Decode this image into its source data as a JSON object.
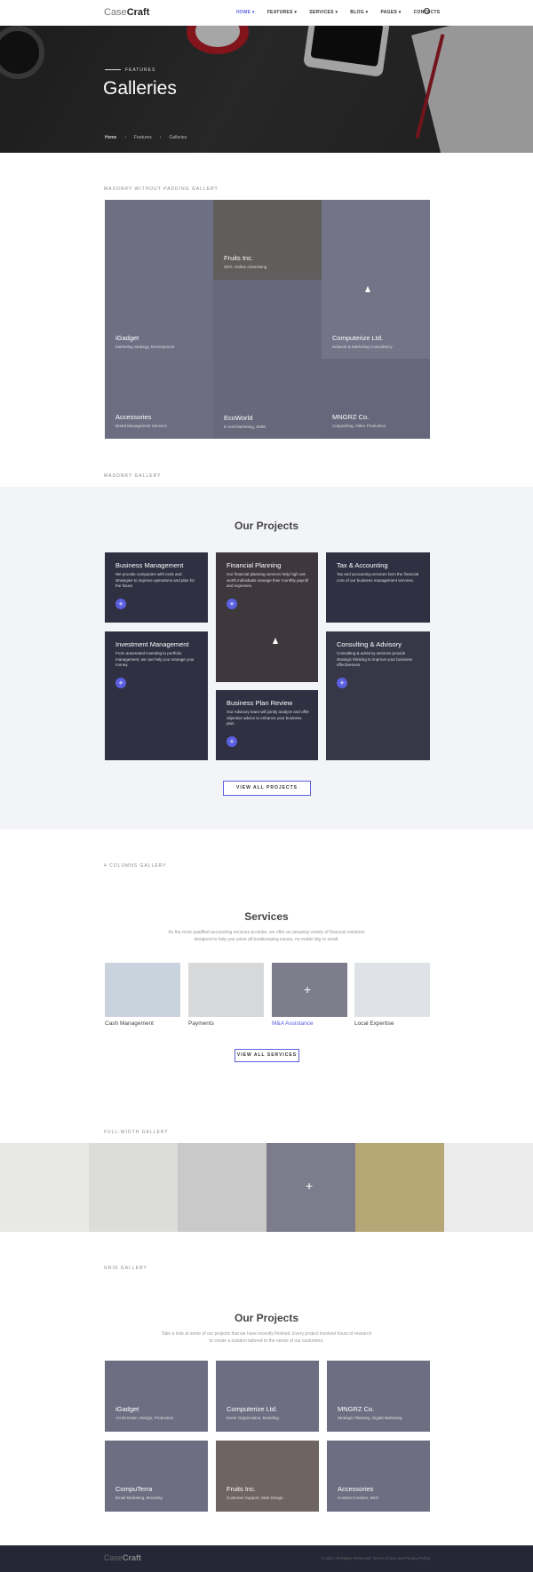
{
  "header": {
    "logo_part1": "Case",
    "logo_part2": "Craft",
    "nav": [
      "HOME",
      "FEATURES",
      "SERVICES",
      "BLOG",
      "PAGES",
      "CONTACTS"
    ],
    "active_nav": "HOME"
  },
  "hero": {
    "subtitle": "FEATURES",
    "title": "Galleries",
    "breadcrumb": [
      "Home",
      "Features",
      "Galleries"
    ]
  },
  "masonry_nopad": {
    "label": "MASONRY WITHOUT PADDING GALLERY",
    "items": [
      {
        "title": "Fruits Inc.",
        "subtitle": "SEO, Online Advertising"
      },
      {
        "title": "iGadget",
        "subtitle": "Marketing Strategy, Development"
      },
      {
        "title": "Computerize Ltd.",
        "subtitle": "Network & Marketing Consultancy"
      },
      {
        "title": "Accessories",
        "subtitle": "Brand Management Services"
      },
      {
        "title": "EcoWorld",
        "subtitle": "E-mail Marketing, SMM"
      },
      {
        "title": "MNGRZ Co.",
        "subtitle": "Copywriting, Video Production"
      }
    ]
  },
  "masonry": {
    "label": "MASONRY GALLERY",
    "heading": "Our Projects",
    "items": [
      {
        "title": "Business Management",
        "text": "We provide companies with tools and strategies to improve operations and plan for the future."
      },
      {
        "title": "Financial Planning",
        "text": "Our financial planning services help high net-worth individuals manage their monthly payroll and expenses."
      },
      {
        "title": "Tax & Accounting",
        "text": "Tax and accounting services form the financial core of our business management services."
      },
      {
        "title": "Investment Management",
        "text": "From automated investing to portfolio management, we can help you manage your money."
      },
      {
        "title": "Consulting & Advisory",
        "text": "Consulting & advisory services provide strategic thinking to improve your business effectiveness."
      },
      {
        "title": "Business Plan Review",
        "text": "Our Advisory team will jointly analyze and offer objective advice to enhance your business plan."
      }
    ],
    "button": "VIEW ALL PROJECTS"
  },
  "columns": {
    "label": "4 COLUMNS GALLERY",
    "heading": "Services",
    "description": "As the most qualified accounting services provider, we offer an amazing variety of financial solutions designed to help you solve all bookkeeping issues, no matter big or small.",
    "items": [
      "Cash Management",
      "Payments",
      "M&A Assistance",
      "Local Expertise"
    ],
    "active_item": "M&A Assistance",
    "button": "VIEW ALL SERVICES"
  },
  "fullwidth": {
    "label": "FULL-WIDTH GALLERY"
  },
  "grid": {
    "label": "GRID GALLERY",
    "heading": "Our Projects",
    "description": "Take a look at some of our projects that we have recently finished. Every project involved hours of research to create a solution tailored to the needs of our customers.",
    "items": [
      {
        "title": "iGadget",
        "subtitle": "Art Direction, Design, Production"
      },
      {
        "title": "Computerize Ltd.",
        "subtitle": "Event Organization, Branding"
      },
      {
        "title": "MNGRZ Co.",
        "subtitle": "Strategic Planning, Digital Marketing"
      },
      {
        "title": "CompuTerra",
        "subtitle": "Email Marketing, Branding"
      },
      {
        "title": "Fruits Inc.",
        "subtitle": "Customer Support, Web Design"
      },
      {
        "title": "Accessories",
        "subtitle": "Content Creation, SEO"
      }
    ]
  },
  "footer": {
    "logo_part1": "Case",
    "logo_part2": "Craft",
    "copyright": "© 2017 All Rights Reserved. Terms of Use and Privacy Policy"
  },
  "colors": {
    "accent": "#5a5fe0",
    "footer": "#262637",
    "gray_section": "#f3f4f8"
  },
  "icons": [
    "search-icon",
    "plus-icon",
    "chevron-down-icon"
  ]
}
